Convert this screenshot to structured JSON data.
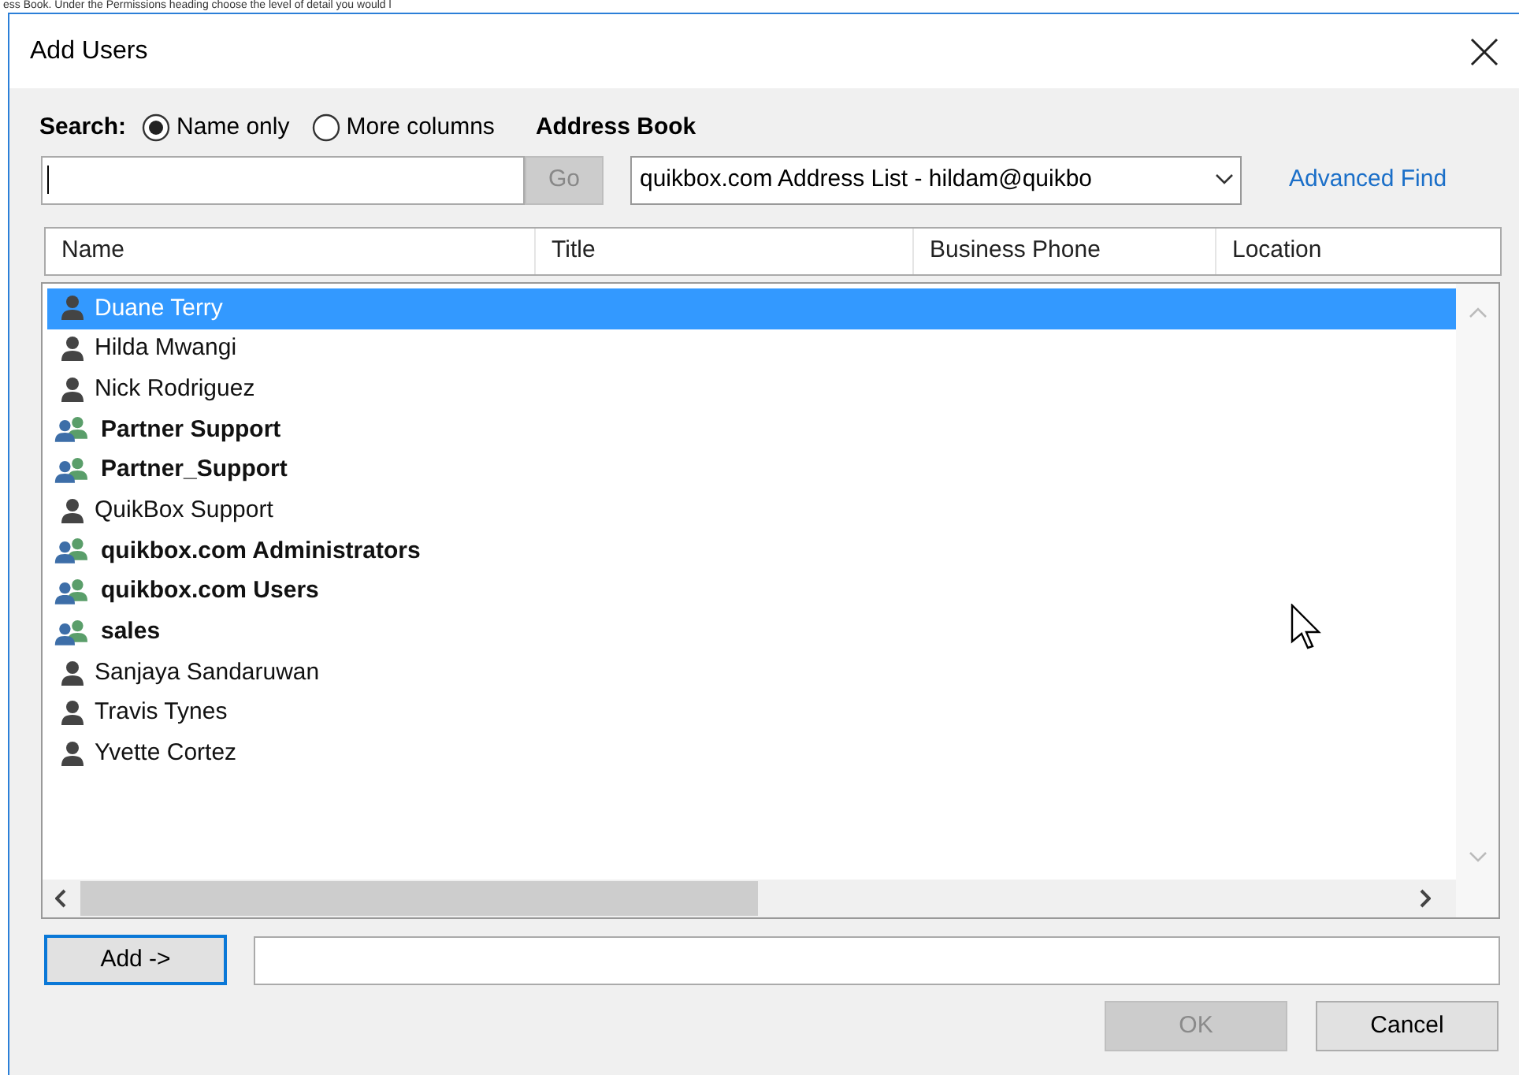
{
  "background_text": "ess Book.  Under the Permissions heading choose the level of detail you would l",
  "window": {
    "title": "Add Users"
  },
  "search": {
    "label": "Search:",
    "options": [
      {
        "label": "Name only",
        "selected": true
      },
      {
        "label": "More columns",
        "selected": false
      }
    ],
    "go_button": {
      "label": "Go",
      "disabled": true
    }
  },
  "address_book": {
    "label": "Address Book",
    "value": "quikbox.com Address List - hildam@quikbo"
  },
  "advanced_find": "Advanced Find",
  "table": {
    "columns": [
      "Name",
      "Title",
      "Business Phone",
      "Location"
    ],
    "rows": [
      {
        "name": "Duane Terry",
        "kind": "person",
        "selected": true
      },
      {
        "name": "Hilda Mwangi",
        "kind": "person",
        "selected": false
      },
      {
        "name": "Nick Rodriguez",
        "kind": "person",
        "selected": false
      },
      {
        "name": "Partner Support",
        "kind": "group",
        "selected": false
      },
      {
        "name": "Partner_Support",
        "kind": "group",
        "selected": false
      },
      {
        "name": "QuikBox Support",
        "kind": "person",
        "selected": false
      },
      {
        "name": "quikbox.com Administrators",
        "kind": "group",
        "selected": false
      },
      {
        "name": "quikbox.com Users",
        "kind": "group",
        "selected": false
      },
      {
        "name": "sales",
        "kind": "group",
        "selected": false
      },
      {
        "name": "Sanjaya Sandaruwan",
        "kind": "person",
        "selected": false
      },
      {
        "name": "Travis Tynes",
        "kind": "person",
        "selected": false
      },
      {
        "name": "Yvette Cortez",
        "kind": "person",
        "selected": false
      }
    ]
  },
  "add_button": "Add ->",
  "buttons": [
    {
      "label": "OK",
      "disabled": true
    },
    {
      "label": "Cancel",
      "disabled": false
    }
  ]
}
